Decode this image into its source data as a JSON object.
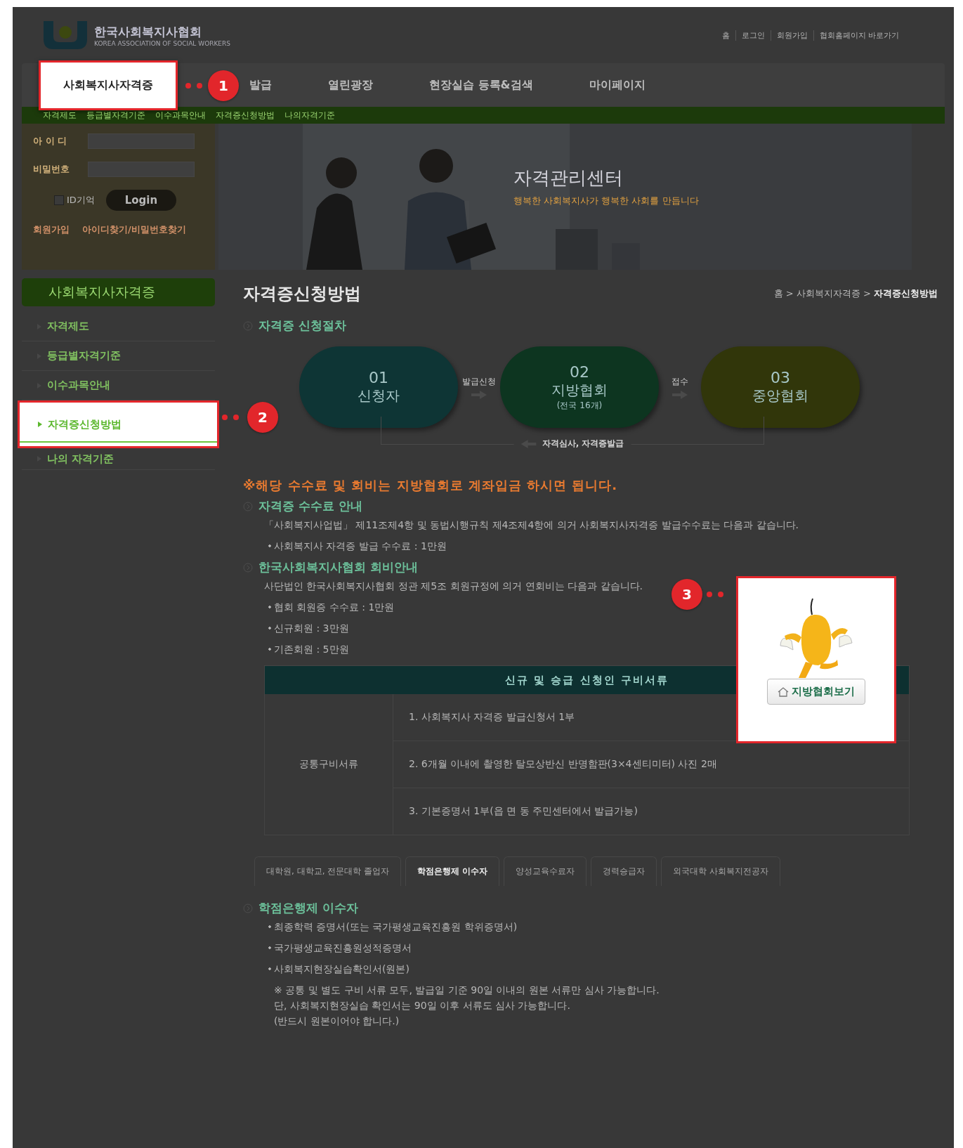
{
  "header": {
    "logo_title": "한국사회복지사협회",
    "logo_subtitle": "KOREA ASSOCIATION OF SOCIAL WORKERS",
    "top_links": [
      "홈",
      "로그인",
      "회원가입",
      "협회홈페이지 바로가기"
    ]
  },
  "nav": [
    {
      "label": "사회복지사자격증",
      "selected": true
    },
    {
      "label": "발급",
      "selected": false
    },
    {
      "label": "열린광장",
      "selected": false
    },
    {
      "label": "현장실습 등록&검색",
      "selected": false
    },
    {
      "label": "마이페이지",
      "selected": false
    }
  ],
  "subnav": [
    "자격제도",
    "등급별자격기준",
    "이수과목안내",
    "자격증신청방법",
    "나의자격기준"
  ],
  "login": {
    "id_label": "아 이 디",
    "pw_label": "비밀번호",
    "remember_label": "ID기억",
    "remember_checked": false,
    "button": "Login",
    "links": [
      "회원가입",
      "아이디찾기/비밀번호찾기"
    ]
  },
  "banner": {
    "kind": "picture",
    "title": "자격관리센터",
    "subtitle": "행복한 사회복지사가 행복한 사회를 만듭니다"
  },
  "sidebar": {
    "title": "사회복지사자격증",
    "items": [
      {
        "label": "자격제도",
        "selected": false
      },
      {
        "label": "등급별자격기준",
        "selected": false
      },
      {
        "label": "이수과목안내",
        "selected": false
      },
      {
        "label": "자격증신청방법",
        "selected": true
      },
      {
        "label": "나의 자격기준",
        "selected": false
      }
    ]
  },
  "page": {
    "title": "자격증신청방법",
    "breadcrumb": "홈 > 사회복지자격증 > **자격증신청방법**"
  },
  "process": {
    "heading": "자격증 신청절차",
    "steps": [
      {
        "number": "01",
        "label": "신청자",
        "color": "#0e3535"
      },
      {
        "number": "02",
        "label": "지방협회",
        "note": "(전국 16개)",
        "color": "#0d3520"
      },
      {
        "number": "03",
        "label": "중앙협회",
        "color": "#31360a"
      }
    ],
    "arrows": [
      "발급신청",
      "접수"
    ],
    "return_label": "자격심사, 자격증발급"
  },
  "notice": "※해당 수수료 및 회비는 지방협회로 계좌입금 하시면 됩니다.",
  "fee": {
    "heading": "자격증 수수료 안내",
    "paragraph": "「사회복지사업법」 제11조제4항 및 동법시행규칙 제4조제4항에 의거 사회복지사자격증 발급수수료는 다음과 같습니다.",
    "bullets": [
      "사회복지사 자격증 발급 수수료 : 1만원"
    ]
  },
  "membership": {
    "heading": "한국사회복지사협회 회비안내",
    "paragraph": "사단법인 한국사회복지사협회 정관 제5조 회원규정에 의거 연회비는 다음과 같습니다.",
    "bullets": [
      "협회 회원증 수수료 : 1만원",
      "신규회원 : 3만원",
      "기존회원 : 5만원"
    ]
  },
  "table": {
    "header": "신규 및 승급 신청인 구비서류",
    "row_label": "공통구비서류",
    "items": [
      "1. 사회복지사 자격증 발급신청서 1부",
      "2. 6개월 이내에 촬영한 탈모상반신 반명함판(3×4센티미터) 사진 2매",
      "3. 기본증명서 1부(읍 면 동 주민센터에서 발급가능)"
    ]
  },
  "tabs": [
    {
      "label": "대학원, 대학교, 전문대학 졸업자",
      "selected": false
    },
    {
      "label": "학점은행제 이수자",
      "selected": true
    },
    {
      "label": "양성교육수료자",
      "selected": false
    },
    {
      "label": "경력승급자",
      "selected": false
    },
    {
      "label": "외국대학 사회복지전공자",
      "selected": false
    }
  ],
  "credit": {
    "heading": "학점은행제 이수자",
    "bullets": [
      "최종학력 증명서(또는 국가평생교육진흥원 학위증명서)",
      "국가평생교육진흥원성적증명서",
      "사회복지현장실습확인서(원본)"
    ],
    "notes": [
      "※ 공통 및 별도 구비 서류 모두, 발급일 기준 90일 이내의 원본 서류만 심사 가능합니다.",
      "단, 사회복지현장실습 확인서는 90일 이후 서류도 심사 가능합니다.",
      "(반드시 원본이어야 합니다.)"
    ]
  },
  "callouts": [
    "1",
    "2",
    "3"
  ],
  "regional_button": "지방협회보기"
}
